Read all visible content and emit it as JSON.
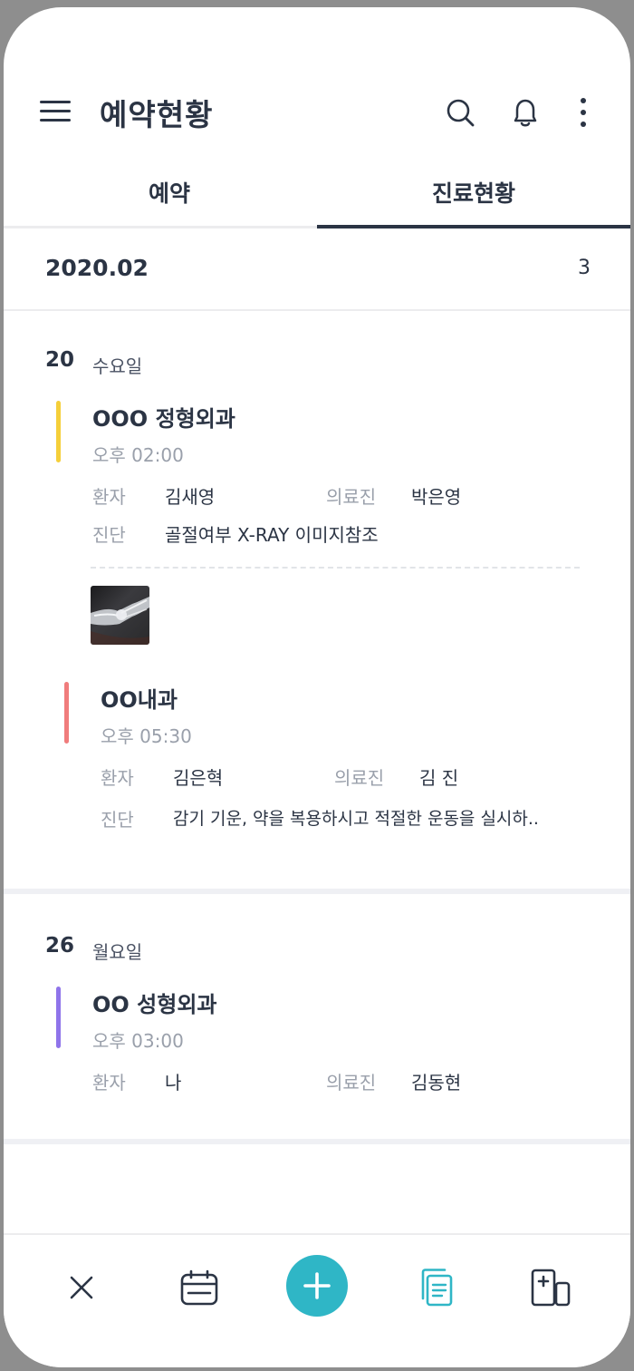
{
  "header": {
    "title": "예약현황",
    "icons": [
      "menu-icon",
      "search-icon",
      "bell-icon",
      "more-vertical-icon"
    ]
  },
  "tabs": [
    {
      "label": "예약",
      "active": false
    },
    {
      "label": "진료현황",
      "active": true
    }
  ],
  "month": {
    "label": "2020.02",
    "count": "3"
  },
  "days": [
    {
      "day": "20",
      "weekday": "수요일",
      "appointments": [
        {
          "title": "OOO 정형외과",
          "time": "오후 02:00",
          "color": "#f5cf3a",
          "patient_label": "환자",
          "patient": "김새영",
          "doctor_label": "의료진",
          "doctor": "박은영",
          "diagnosis_label": "진단",
          "diagnosis": "골절여부 X-RAY 이미지참조"
        },
        {
          "title": "OO내과",
          "time": "오후 05:30",
          "color": "#f07c7c",
          "patient_label": "환자",
          "patient": "김은혁",
          "doctor_label": "의료진",
          "doctor": "김 진",
          "diagnosis_label": "진단",
          "diagnosis": "감기 기운, 약을 복용하시고 적절한 운동을 실시하.."
        }
      ]
    },
    {
      "day": "26",
      "weekday": "월요일",
      "appointments": [
        {
          "title": "OO 성형외과",
          "time": "오후 03:00",
          "color": "#8f74ea",
          "patient_label": "환자",
          "patient": "나",
          "doctor_label": "의료진",
          "doctor": "김동현"
        }
      ]
    }
  ],
  "bottom_nav": {
    "items": [
      "close-icon",
      "calendar-icon",
      "add-icon",
      "document-icon",
      "add-device-icon"
    ],
    "accent": "#2fb6c6"
  }
}
